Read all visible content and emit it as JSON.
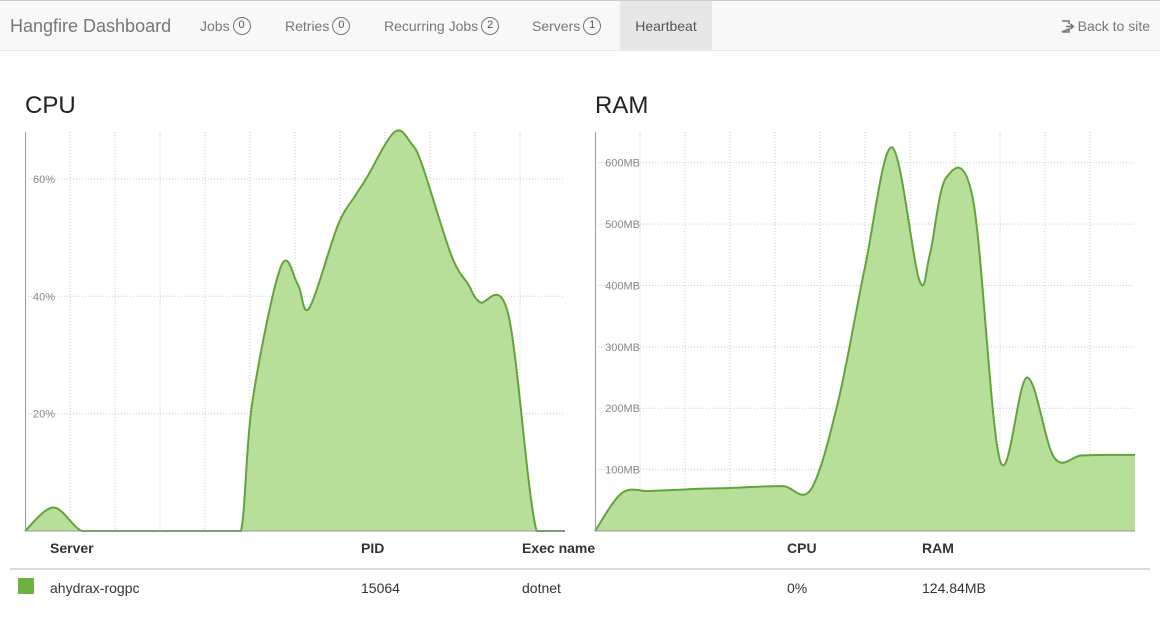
{
  "nav": {
    "brand": "Hangfire Dashboard",
    "items": [
      {
        "label": "Jobs",
        "badge": "0"
      },
      {
        "label": "Retries",
        "badge": "0"
      },
      {
        "label": "Recurring Jobs",
        "badge": "2"
      },
      {
        "label": "Servers",
        "badge": "1"
      },
      {
        "label": "Heartbeat"
      }
    ],
    "back_label": "Back to site"
  },
  "colors": {
    "series_line": "#62a33c",
    "series_fill": "#b8df9a",
    "swatch": "#6cb33e"
  },
  "chart_data": [
    {
      "type": "area",
      "title": "CPU",
      "y_unit": "%",
      "ylim": [
        0,
        68
      ],
      "yticks": [
        20,
        40,
        60
      ],
      "ytick_labels": [
        "20%",
        "40%",
        "60%"
      ],
      "grid": true,
      "x": [
        0,
        5,
        10,
        15,
        20,
        25,
        30,
        35,
        38,
        40,
        45,
        48,
        50,
        55,
        58,
        60,
        65,
        68,
        70,
        75,
        78,
        80,
        85,
        90,
        95
      ],
      "values": [
        0,
        4,
        0,
        0,
        0,
        0,
        0,
        0,
        0,
        22,
        45,
        42,
        38,
        52,
        57,
        60,
        68,
        66,
        62,
        47,
        42,
        39,
        37,
        0,
        0
      ]
    },
    {
      "type": "area",
      "title": "RAM",
      "y_unit": "MB",
      "ylim": [
        0,
        650
      ],
      "yticks": [
        100,
        200,
        300,
        400,
        500,
        600
      ],
      "ytick_labels": [
        "100MB",
        "200MB",
        "300MB",
        "400MB",
        "500MB",
        "600MB"
      ],
      "grid": true,
      "x": [
        0,
        5,
        10,
        15,
        20,
        25,
        30,
        35,
        40,
        45,
        50,
        55,
        60,
        62,
        65,
        70,
        75,
        80,
        85,
        90,
        95,
        100
      ],
      "values": [
        0,
        62,
        65,
        67,
        69,
        70,
        72,
        73,
        68,
        210,
        430,
        625,
        410,
        450,
        575,
        540,
        115,
        250,
        120,
        123,
        124,
        124
      ]
    }
  ],
  "table": {
    "headers": [
      "Server",
      "PID",
      "Exec name",
      "CPU",
      "RAM"
    ],
    "rows": [
      {
        "server": "ahydrax-rogpc",
        "pid": "15064",
        "exec": "dotnet",
        "cpu": "0%",
        "ram": "124.84MB"
      }
    ]
  }
}
